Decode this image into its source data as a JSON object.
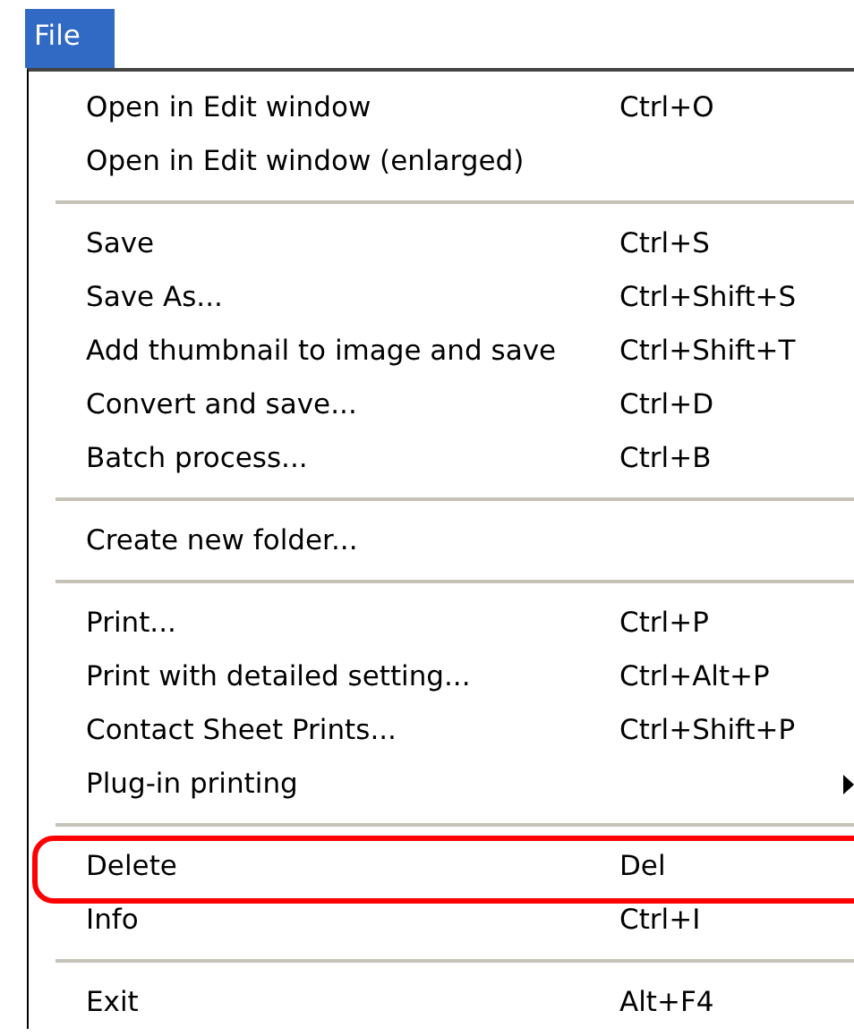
{
  "menu_title": "File",
  "items": [
    {
      "kind": "item",
      "label": "Open in Edit window",
      "shortcut": "Ctrl+O",
      "submenu": false,
      "highlighted": false
    },
    {
      "kind": "item",
      "label": "Open in Edit window (enlarged)",
      "submenu": false,
      "highlighted": false
    },
    {
      "kind": "separator"
    },
    {
      "kind": "item",
      "label": "Save",
      "shortcut": "Ctrl+S",
      "submenu": false,
      "highlighted": false
    },
    {
      "kind": "item",
      "label": "Save As...",
      "shortcut": "Ctrl+Shift+S",
      "submenu": false,
      "highlighted": false
    },
    {
      "kind": "item",
      "label": "Add thumbnail to image and save",
      "shortcut": "Ctrl+Shift+T",
      "submenu": false,
      "highlighted": false
    },
    {
      "kind": "item",
      "label": "Convert and save...",
      "shortcut": "Ctrl+D",
      "submenu": false,
      "highlighted": false
    },
    {
      "kind": "item",
      "label": "Batch process...",
      "shortcut": "Ctrl+B",
      "submenu": false,
      "highlighted": false
    },
    {
      "kind": "separator"
    },
    {
      "kind": "item",
      "label": "Create new folder...",
      "submenu": false,
      "highlighted": false
    },
    {
      "kind": "separator"
    },
    {
      "kind": "item",
      "label": "Print...",
      "shortcut": "Ctrl+P",
      "submenu": false,
      "highlighted": false
    },
    {
      "kind": "item",
      "label": "Print with detailed setting...",
      "shortcut": "Ctrl+Alt+P",
      "submenu": false,
      "highlighted": false
    },
    {
      "kind": "item",
      "label": "Contact Sheet Prints...",
      "shortcut": "Ctrl+Shift+P",
      "submenu": false,
      "highlighted": false
    },
    {
      "kind": "item",
      "label": "Plug-in printing",
      "submenu": true,
      "highlighted": false
    },
    {
      "kind": "separator"
    },
    {
      "kind": "item",
      "label": "Delete",
      "shortcut": "Del",
      "submenu": false,
      "highlighted": true
    },
    {
      "kind": "item",
      "label": "Info",
      "shortcut": "Ctrl+I",
      "submenu": false,
      "highlighted": false
    },
    {
      "kind": "separator"
    },
    {
      "kind": "item",
      "label": "Exit",
      "shortcut": "Alt+F4",
      "submenu": false,
      "highlighted": false
    }
  ]
}
